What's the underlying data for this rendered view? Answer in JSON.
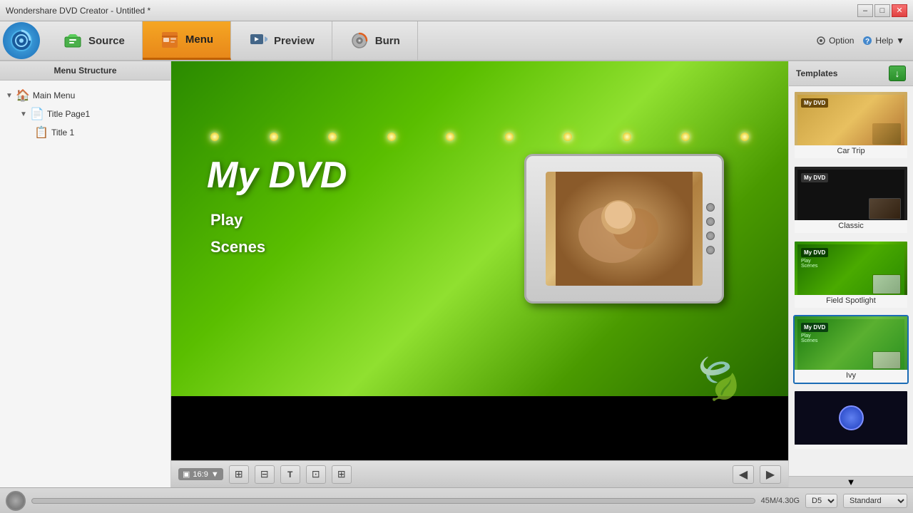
{
  "titlebar": {
    "title": "Wondershare DVD Creator - Untitled *",
    "min_btn": "–",
    "max_btn": "□",
    "close_btn": "✕"
  },
  "toolbar": {
    "logo_icon": "⚙",
    "source_label": "Source",
    "menu_label": "Menu",
    "preview_label": "Preview",
    "burn_label": "Burn",
    "option_label": "Option",
    "help_label": "Help"
  },
  "left_panel": {
    "title": "Menu Structure",
    "tree": [
      {
        "level": 1,
        "label": "Main Menu",
        "icon": "🏠",
        "type": "main",
        "expanded": true
      },
      {
        "level": 2,
        "label": "Title Page1",
        "icon": "📄",
        "type": "page",
        "expanded": true
      },
      {
        "level": 3,
        "label": "Title 1",
        "icon": "📋",
        "type": "title"
      }
    ]
  },
  "preview": {
    "dvd_title": "My DVD",
    "menu_items": [
      "Play",
      "Scenes"
    ],
    "aspect_ratio": "16:9",
    "spotlights_count": 10
  },
  "preview_tools": {
    "aspect_label": "16:9",
    "tool_icons": [
      "▣",
      "⊞",
      "T",
      "⊡",
      "⊞"
    ]
  },
  "templates_panel": {
    "title": "Templates",
    "download_icon": "↓",
    "items": [
      {
        "id": "car-trip",
        "label": "Car Trip",
        "selected": false
      },
      {
        "id": "classic",
        "label": "Classic",
        "selected": false
      },
      {
        "id": "field-spotlight",
        "label": "Field Spotlight",
        "selected": false
      },
      {
        "id": "ivy",
        "label": "Ivy",
        "selected": true
      },
      {
        "id": "dark5",
        "label": "",
        "selected": false
      }
    ]
  },
  "statusbar": {
    "disk_info": "45M/4.30G",
    "disk_type": "D5",
    "quality": "Standard"
  }
}
